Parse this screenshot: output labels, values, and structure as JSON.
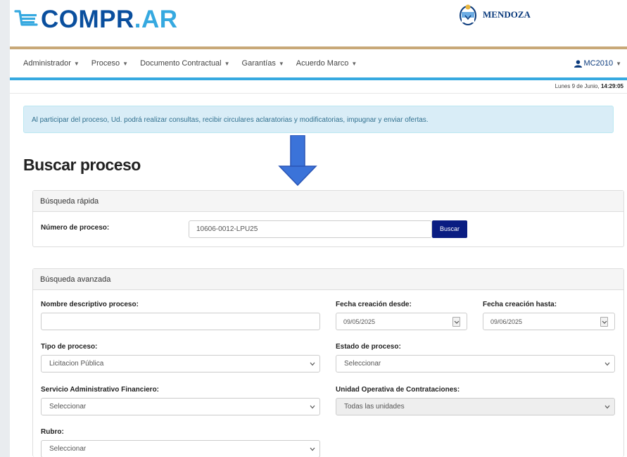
{
  "header": {
    "logo_main": "COMPR",
    "logo_dot": ".",
    "logo_suffix": "AR",
    "province": "MENDOZA"
  },
  "nav": {
    "items": [
      {
        "label": "Administrador"
      },
      {
        "label": "Proceso"
      },
      {
        "label": "Documento Contractual"
      },
      {
        "label": "Garantías"
      },
      {
        "label": "Acuerdo Marco"
      }
    ],
    "user": "MC2010"
  },
  "datebar": {
    "date": "Lunes 9 de Junio,",
    "time": "14:29:05"
  },
  "alert": {
    "text": "Al participar del proceso, Ud. podrá realizar consultas, recibir circulares aclaratorias y modificatorias, impugnar y enviar ofertas."
  },
  "page_title": "Buscar proceso",
  "quick_search": {
    "heading": "Búsqueda rápida",
    "label": "Número de proceso:",
    "value": "10606-0012-LPU25",
    "button": "Buscar"
  },
  "advanced_search": {
    "heading": "Búsqueda avanzada",
    "name_label": "Nombre descriptivo proceso:",
    "name_value": "",
    "date_from_label": "Fecha creación desde:",
    "date_from_value": "09/05/2025",
    "date_to_label": "Fecha creación hasta:",
    "date_to_value": "09/06/2025",
    "type_label": "Tipo de proceso:",
    "type_value": "Licitacion Pública",
    "state_label": "Estado de proceso:",
    "state_value": "Seleccionar",
    "saf_label": "Servicio Administrativo Financiero:",
    "saf_value": "Seleccionar",
    "uoc_label": "Unidad Operativa de Contrataciones:",
    "uoc_value": "Todas las unidades",
    "rubro_label": "Rubro:",
    "rubro_value": "Seleccionar"
  },
  "colors": {
    "brand_dark": "#0a4f9e",
    "brand_light": "#36a9e0",
    "button": "#0a1d82",
    "gold": "#c8a878",
    "arrow": "#3b73d9"
  }
}
